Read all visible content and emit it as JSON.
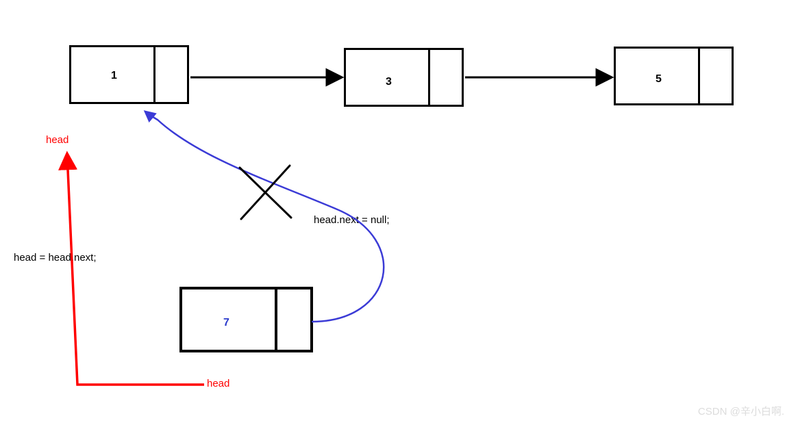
{
  "nodes": {
    "n1": {
      "value": "1"
    },
    "n3": {
      "value": "3"
    },
    "n5": {
      "value": "5"
    },
    "n7": {
      "value": "7"
    }
  },
  "labels": {
    "head_top": "head",
    "head_bottom": "head",
    "assign_head": "head = head.next;",
    "null_next": "head.next = null;"
  },
  "watermark": "CSDN @辛小白啊.",
  "colors": {
    "border": "#000000",
    "arrow": "#000000",
    "head_pointer": "#ff0000",
    "curve": "#3b3bd6",
    "cross": "#000000",
    "node7_value": "#2b3bcc"
  }
}
